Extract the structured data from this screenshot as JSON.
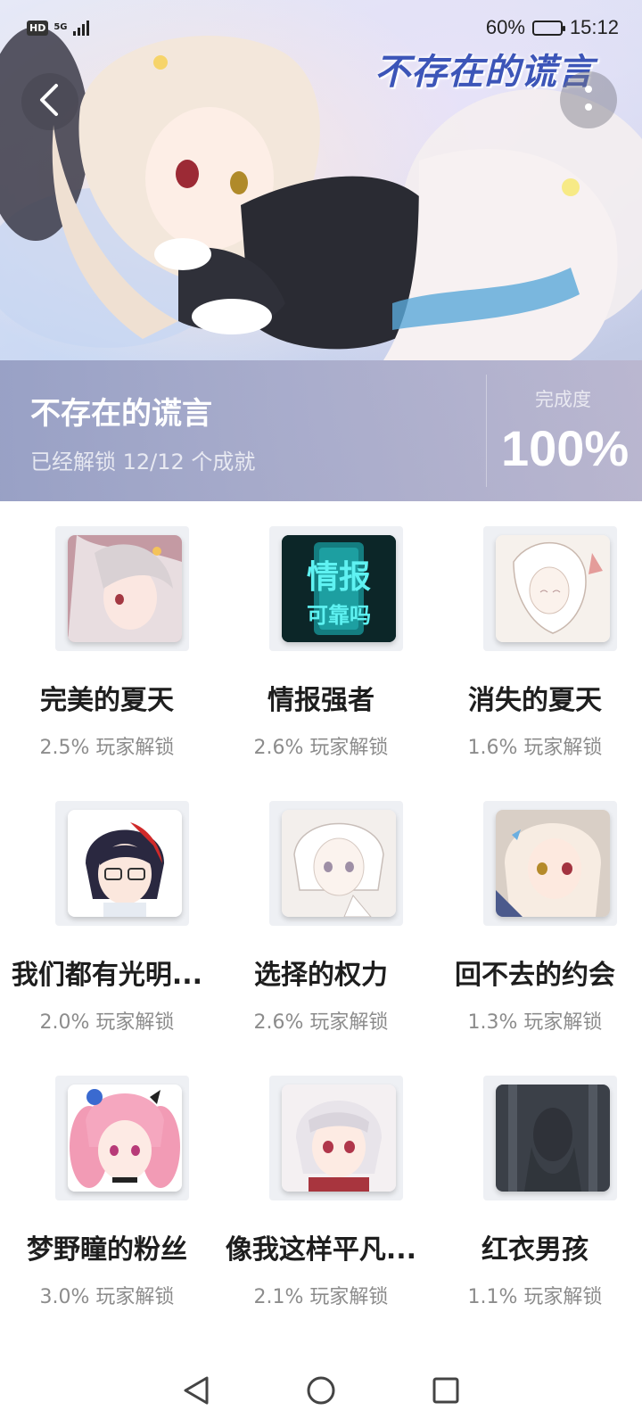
{
  "status_bar": {
    "hd": "HD",
    "signal": "5G",
    "battery": "60%",
    "time": "15:12"
  },
  "hero": {
    "logo_text": "不存在的谎言",
    "game_title": "不存在的谎言",
    "unlock_text": "已经解锁 12/12 个成就",
    "completion_label": "完成度",
    "completion_value": "100%"
  },
  "achievements": [
    {
      "name": "完美的夏天",
      "rate": "2.5% 玩家解锁"
    },
    {
      "name": "情报强者",
      "rate": "2.6% 玩家解锁",
      "thumb_text_1": "情报",
      "thumb_text_2": "可靠吗"
    },
    {
      "name": "消失的夏天",
      "rate": "1.6% 玩家解锁"
    },
    {
      "name": "我们都有光明...",
      "rate": "2.0% 玩家解锁"
    },
    {
      "name": "选择的权力",
      "rate": "2.6% 玩家解锁"
    },
    {
      "name": "回不去的约会",
      "rate": "1.3% 玩家解锁"
    },
    {
      "name": "梦野瞳的粉丝",
      "rate": "3.0% 玩家解锁"
    },
    {
      "name": "像我这样平凡...",
      "rate": "2.1% 玩家解锁"
    },
    {
      "name": "红衣男孩",
      "rate": "1.1% 玩家解锁"
    }
  ],
  "icons": {
    "back": "chevron-left-icon",
    "more": "more-vertical-icon",
    "nav_back": "triangle-back-icon",
    "nav_home": "circle-home-icon",
    "nav_recent": "square-recent-icon"
  },
  "colors": {
    "accent_logo": "#3c55b8",
    "title_text": "#1e1e1e",
    "rate_text": "#8c8c8c"
  }
}
